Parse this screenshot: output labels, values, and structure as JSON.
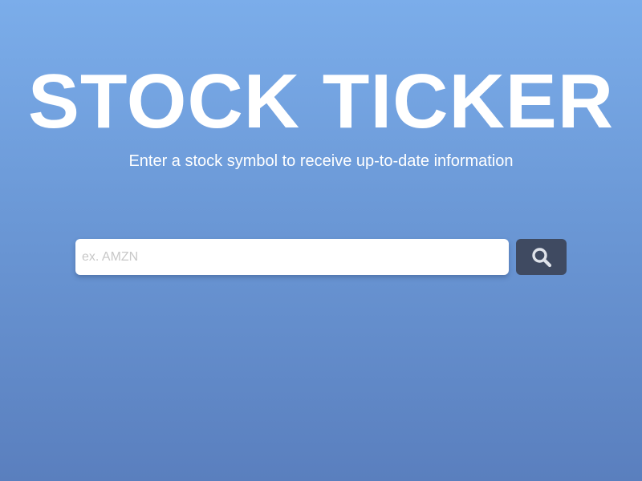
{
  "header": {
    "title": "STOCK TICKER",
    "subtitle": "Enter a stock symbol to receive up-to-date information"
  },
  "search": {
    "placeholder": "ex. AMZN",
    "value": "",
    "button_icon": "search-icon"
  },
  "colors": {
    "background_top": "#7badea",
    "background_bottom": "#5a7fbe",
    "button": "#3f4a61",
    "icon": "#dfe3ea",
    "text": "#ffffff"
  }
}
